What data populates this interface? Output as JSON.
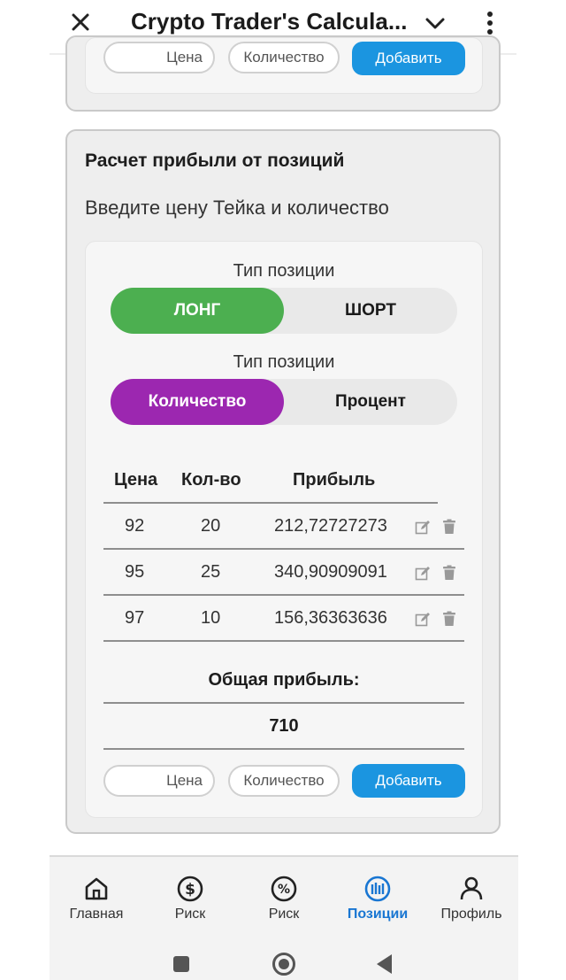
{
  "app": {
    "title": "Crypto Trader's Calcula..."
  },
  "top_card": {
    "price_label": "Цена",
    "qty_label": "Количество",
    "add_label": "Добавить"
  },
  "profit_card": {
    "title": "Расчет прибыли от позиций",
    "subtitle": "Введите цену Тейка и количество",
    "position_type_label": "Тип позиции",
    "long_label": "ЛОНГ",
    "short_label": "ШОРТ",
    "mode_type_label": "Тип позиции",
    "qty_mode_label": "Количество",
    "percent_mode_label": "Процент",
    "table": {
      "headers": [
        "Цена",
        "Кол-во",
        "Прибыль"
      ],
      "rows": [
        {
          "price": "92",
          "qty": "20",
          "profit": "212,72727273"
        },
        {
          "price": "95",
          "qty": "25",
          "profit": "340,90909091"
        },
        {
          "price": "97",
          "qty": "10",
          "profit": "156,36363636"
        }
      ]
    },
    "total_label": "Общая прибыль:",
    "total_value": "710",
    "price_label": "Цена",
    "qty_label": "Количество",
    "add_label": "Добавить"
  },
  "nav": {
    "items": [
      {
        "label": "Главная",
        "icon": "home-icon"
      },
      {
        "label": "Риск",
        "icon": "dollar-icon"
      },
      {
        "label": "Риск",
        "icon": "percent-icon"
      },
      {
        "label": "Позиции",
        "icon": "chart-bars-icon",
        "active": true
      },
      {
        "label": "Профиль",
        "icon": "person-icon"
      }
    ]
  },
  "colors": {
    "long": "#4caf50",
    "qty_mode": "#9c27b0",
    "add_button": "#1b95e0",
    "nav_active": "#1976d2"
  }
}
